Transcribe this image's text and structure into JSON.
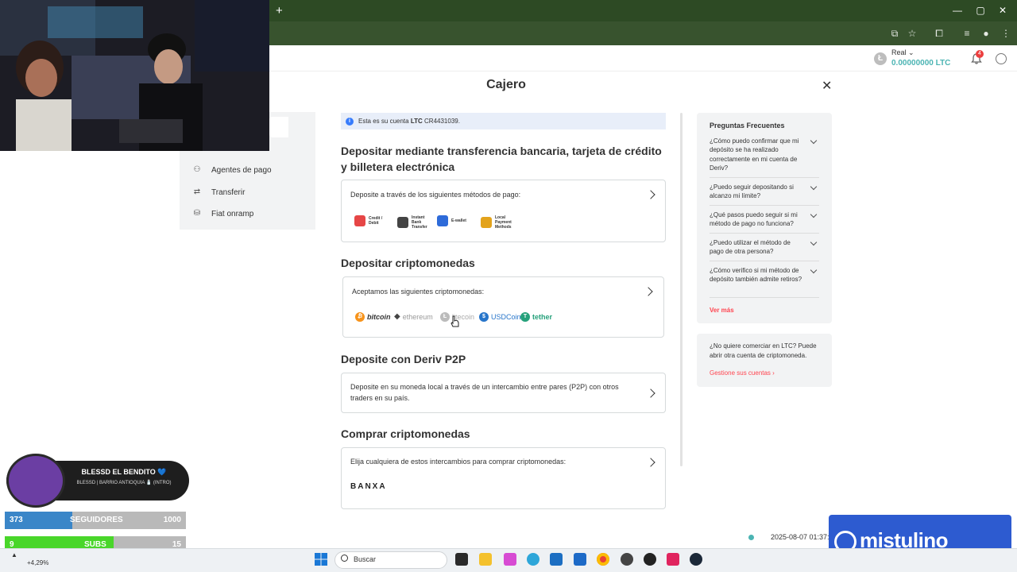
{
  "header": {
    "account_type": "Real",
    "balance": "0.00000000 LTC",
    "notification_count": "4"
  },
  "page": {
    "title": "Cajero"
  },
  "sidebar": {
    "items": [
      {
        "label": "Agentes de pago",
        "icon": "payment-agent-icon"
      },
      {
        "label": "Transferir",
        "icon": "transfer-icon"
      },
      {
        "label": "Fiat onramp",
        "icon": "fiat-onramp-icon"
      }
    ]
  },
  "info": {
    "prefix": "Esta es su cuenta",
    "currency": "LTC",
    "account_id": "CR4431039."
  },
  "sections": {
    "bank": {
      "heading": "Depositar mediante transferencia bancaria, tarjeta de crédito y billetera electrónica",
      "card_text": "Deposite a través de los siguientes métodos de pago:",
      "methods": [
        "Credit / Debit",
        "Instant Bank Transfer",
        "E-wallet",
        "Local Payment Methods"
      ]
    },
    "crypto": {
      "heading": "Depositar criptomonedas",
      "card_text": "Aceptamos las siguientes criptomonedas:",
      "coins": [
        "bitcoin",
        "ethereum",
        "litecoin",
        "USDCoin",
        "tether"
      ]
    },
    "p2p": {
      "heading": "Deposite con Deriv P2P",
      "card_text": "Deposite en su moneda local a través de un intercambio entre pares (P2P) con otros traders en su país."
    },
    "buy": {
      "heading": "Comprar criptomonedas",
      "card_text": "Elija cualquiera de estos intercambios para comprar criptomonedas:",
      "exchange": "BANXA"
    }
  },
  "faq": {
    "title": "Preguntas Frecuentes",
    "items": [
      "¿Cómo puedo confirmar que mi depósito se ha realizado correctamente en mi cuenta de Deriv?",
      "¿Puedo seguir depositando si alcanzo mi límite?",
      "¿Qué pasos puedo seguir si mi método de pago no funciona?",
      "¿Puedo utilizar el método de pago de otra persona?",
      "¿Cómo verifico si mi método de depósito también admite retiros?"
    ],
    "more": "Ver más"
  },
  "other_currency": {
    "text": "¿No quiere comerciar en LTC? Puede abrir otra cuenta de criptomoneda.",
    "link": "Gestione sus cuentas"
  },
  "stream": {
    "name": "BLESSD EL BENDITO 💙",
    "subtitle": "BLESSD | BARRIO ANTIOQUIA 🧂 (INTRO)",
    "followers": {
      "current": "373",
      "label": "SEGUIDORES",
      "goal": "1000",
      "progress": 0.373
    },
    "subs": {
      "current": "9",
      "label": "SUBS",
      "goal": "15",
      "progress": 0.6
    },
    "badge": "mistulino"
  },
  "taskbar": {
    "search_placeholder": "Buscar",
    "stock_change": "+4,29%",
    "timestamp": "2025-08-07 01:37:1"
  },
  "colors": {
    "accent": "#ff444f",
    "teal": "#4bb4b3",
    "chrome": "#2d4a24"
  }
}
